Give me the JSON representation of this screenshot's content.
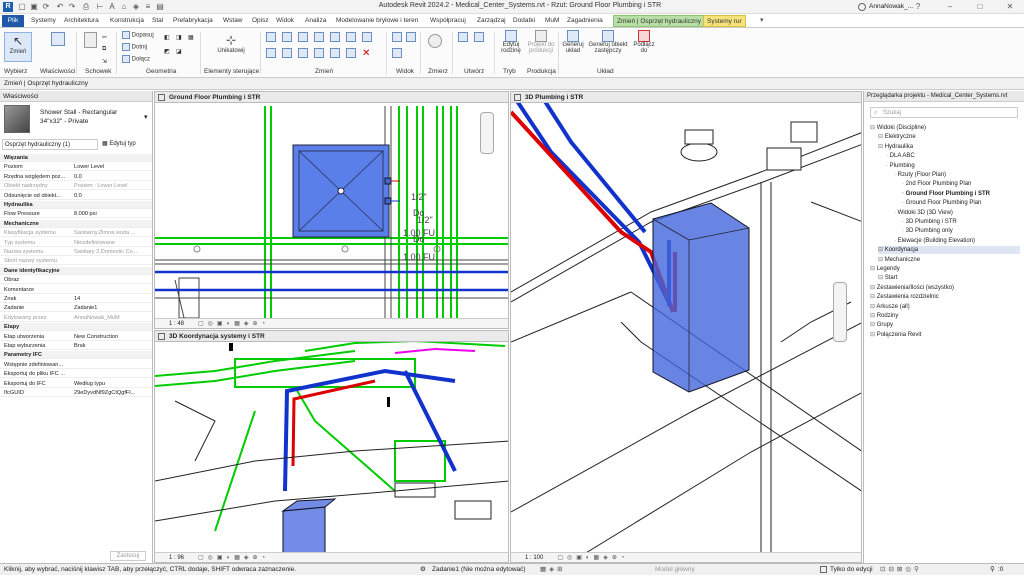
{
  "app": {
    "title": "Autodesk Revit 2024.2 - Medical_Center_Systems.rvt - Rzut: Ground Floor Plumbing i STR",
    "user": "AnnaNowak_..."
  },
  "tabs": [
    "Plik",
    "Systemy",
    "Architektura",
    "Konstrukcja",
    "Stal",
    "Prefabrykacja",
    "Wstaw",
    "Opisz",
    "Widok",
    "Analiza",
    "Modelowanie bryłowe i teren",
    "Współpracuj",
    "Zarządzaj",
    "Dodatki",
    "MuM",
    "Zagadnienia",
    "Zmień | Osprzęt hydrauliczny",
    "Systemy rur"
  ],
  "ribbon": {
    "modify": "Zmień",
    "select": "Wybierz",
    "properties": "Właściwości",
    "clipboard": "Schowek",
    "geometry": "Geometria",
    "geo_btns": [
      "Dopasuj",
      "Dotnij",
      "Dołącz"
    ],
    "ctrl_elems": "Elementy sterujące",
    "unique": "Unikatowij",
    "modify_panel": "Zmień",
    "view": "Widok",
    "measure": "Zmierz",
    "create": "Utwórz",
    "edit_family": "Edytuj rodzinę",
    "project_to_prod": "Projekt do produkcji",
    "gen_layout": "Generuj układ",
    "gen_alt": "Generuj obiekt zastępczy",
    "connect": "Podłącz do",
    "mode": "Tryb",
    "production": "Produkcja",
    "layout": "Układ"
  },
  "context": "Zmień | Osprzęt hydrauliczny",
  "props": {
    "header": "Właściwości",
    "type_name": "Shower Stall - Rectangular",
    "type_size": "34\"x32\" - Private",
    "filter": "Osprzęt hydrauliczny (1)",
    "edit_type": "Edytuj typ",
    "rows": [
      {
        "s": 1,
        "k": "Więzania"
      },
      {
        "k": "Poziom",
        "v": "Lower Level"
      },
      {
        "k": "Rzędna względem poz...",
        "v": "0.0"
      },
      {
        "k": "Obiekt nadrzędny",
        "v": "Poziom : Lower Level",
        "d": 1
      },
      {
        "k": "Odsunięcie od obiekt...",
        "v": "0.0"
      },
      {
        "s": 1,
        "k": "Hydraulika"
      },
      {
        "k": "Flow Pressure",
        "v": "8.000 psi"
      },
      {
        "s": 1,
        "k": "Mechaniczne"
      },
      {
        "k": "Klasyfikacja systemu",
        "v": "Sanitarny,Zimna woda ...",
        "d": 1
      },
      {
        "k": "Typ systemu",
        "v": "Niezdefiniowane",
        "d": 1
      },
      {
        "k": "Nazwa systemu",
        "v": "Sanitary 2,Domestic Co...",
        "d": 1
      },
      {
        "k": "Skrót nazwy systemu",
        "v": "",
        "d": 1
      },
      {
        "s": 1,
        "k": "Dane identyfikacyjne"
      },
      {
        "k": "Obraz",
        "v": ""
      },
      {
        "k": "Komentarze",
        "v": ""
      },
      {
        "k": "Znak",
        "v": "14"
      },
      {
        "k": "Zadanie",
        "v": "Zadanie1"
      },
      {
        "k": "Edytowany przez",
        "v": "AnnaNowak_MuM",
        "d": 1
      },
      {
        "s": 1,
        "k": "Etapy"
      },
      {
        "k": "Etap utworzenia",
        "v": "New Construction"
      },
      {
        "k": "Etap wyburzenia",
        "v": "Brak"
      },
      {
        "s": 1,
        "k": "Parametry IFC"
      },
      {
        "k": "Wstępnie zdefiniowan...",
        "v": ""
      },
      {
        "k": "Eksportuj do pliku IFC ...",
        "v": ""
      },
      {
        "k": "Eksportuj do IFC",
        "v": "Według typu"
      },
      {
        "k": "IfcGUID",
        "v": "29eDyvdNf9ZgCtQgfFl..."
      }
    ],
    "apply": "Zastosuj"
  },
  "views": {
    "v1": {
      "title": "Ground Floor Plumbing i STR",
      "scale": "1 : 48",
      "labels": [
        "1/2\"",
        "Do",
        "1.00 FU",
        "1/2\"",
        "Do",
        "1.00 FU"
      ]
    },
    "v2": {
      "title": "3D Koordynacja systemy i STR",
      "scale": "1 : 96"
    },
    "v3": {
      "title": "3D Plumbing i STR",
      "scale": "1 : 100"
    }
  },
  "browser": {
    "header": "Przeglądarka projektu - Medical_Center_Systems.rvt",
    "search": "Szukaj",
    "items": [
      {
        "t": "Widoki (Discipline)",
        "l": 0
      },
      {
        "t": "Elektryczne",
        "l": 1
      },
      {
        "t": "Hydraulika",
        "l": 1
      },
      {
        "t": "DLA ABC",
        "l": 2
      },
      {
        "t": "Plumbing",
        "l": 2
      },
      {
        "t": "Rzuty (Floor Plan)",
        "l": 3
      },
      {
        "t": "2nd Floor Plumbing Plan",
        "l": 4
      },
      {
        "t": "Ground Floor Plumbing i STR",
        "l": 4,
        "b": 1
      },
      {
        "t": "Ground Floor Plumbing Plan",
        "l": 4
      },
      {
        "t": "Widoki 3D (3D View)",
        "l": 3
      },
      {
        "t": "3D Plumbing i STR",
        "l": 4
      },
      {
        "t": "3D Plumbing only",
        "l": 4
      },
      {
        "t": "Elewacje (Building Elevation)",
        "l": 3
      },
      {
        "t": "Koordynacja",
        "l": 1,
        "h": 1
      },
      {
        "t": "Mechaniczne",
        "l": 1
      },
      {
        "t": "Legendy",
        "l": 0
      },
      {
        "t": "Start",
        "l": 1
      },
      {
        "t": "Zestawienia/Ilości (wszystko)",
        "l": 0
      },
      {
        "t": "Zestawienia rozdzielnic",
        "l": 0
      },
      {
        "t": "Arkusze (all)",
        "l": 0
      },
      {
        "t": "Rodziny",
        "l": 0
      },
      {
        "t": "Grupy",
        "l": 0
      },
      {
        "t": "Połączenia Revit",
        "l": 0
      }
    ]
  },
  "status": {
    "hint": "Kliknij, aby wybrać, naciśnij klawisz TAB, aby przełączyć, CTRL dodaje, SHIFT odwraca zaznaczenie.",
    "workset": "Zadanie1 (Nie można edytować)",
    "model": "Model główny",
    "editable": "Tylko do edycji",
    "zero": ":0"
  }
}
